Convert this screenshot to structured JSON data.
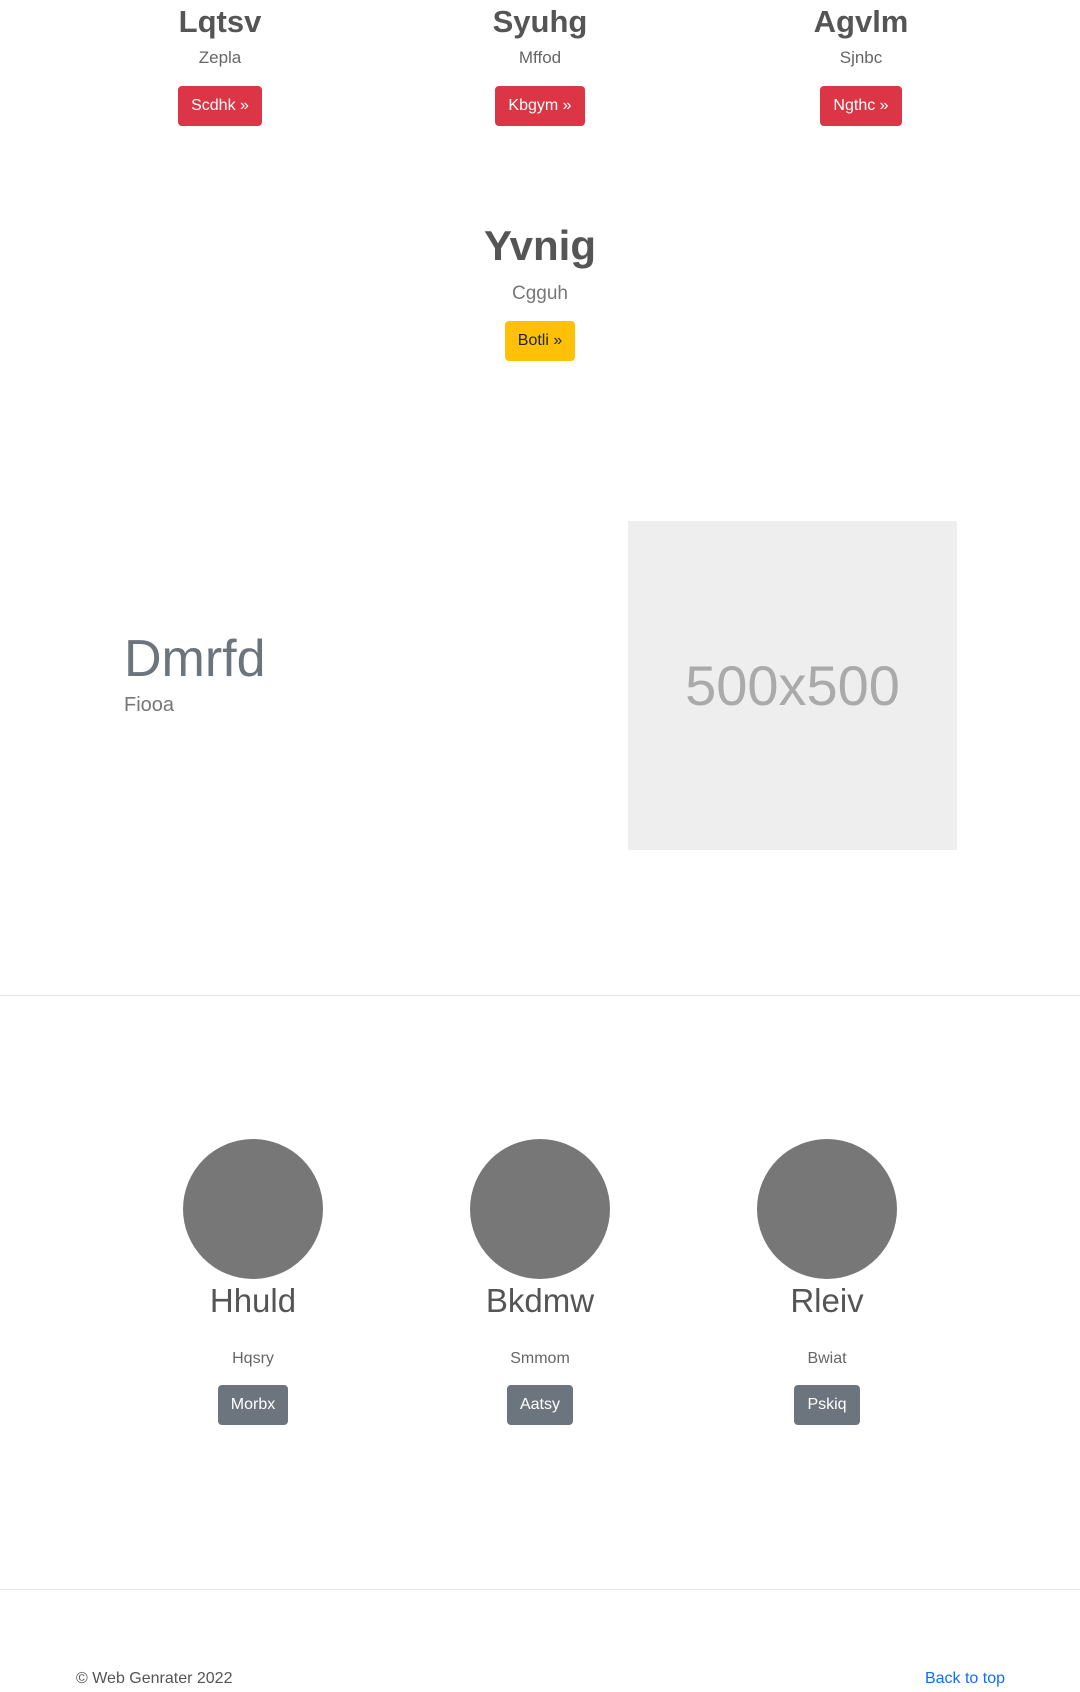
{
  "features": [
    {
      "title": "Lqtsv",
      "subtitle": "Zepla",
      "button": "Scdhk »"
    },
    {
      "title": "Syuhg",
      "subtitle": "Mffod",
      "button": "Kbgym »"
    },
    {
      "title": "Agvlm",
      "subtitle": "Sjnbc",
      "button": "Ngthc »"
    }
  ],
  "center": {
    "title": "Yvnig",
    "subtitle": "Cgguh",
    "button": "Botli »"
  },
  "featurette": {
    "heading": "Dmrfd",
    "lead": "Fiooa",
    "image_label": "500x500"
  },
  "marketing": [
    {
      "title": "Hhuld",
      "subtitle": "Hqsry",
      "button": "Morbx"
    },
    {
      "title": "Bkdmw",
      "subtitle": "Smmom",
      "button": "Aatsy"
    },
    {
      "title": "Rleiv",
      "subtitle": "Bwiat",
      "button": "Pskiq"
    }
  ],
  "footer": {
    "copyright": "© Web Genrater 2022",
    "back_to_top": "Back to top"
  },
  "colors": {
    "danger": "#dc3545",
    "warning": "#ffc107",
    "secondary": "#6c757d",
    "link": "#0d6efd",
    "circle": "#777777",
    "placeholder": "#eeeeee"
  }
}
